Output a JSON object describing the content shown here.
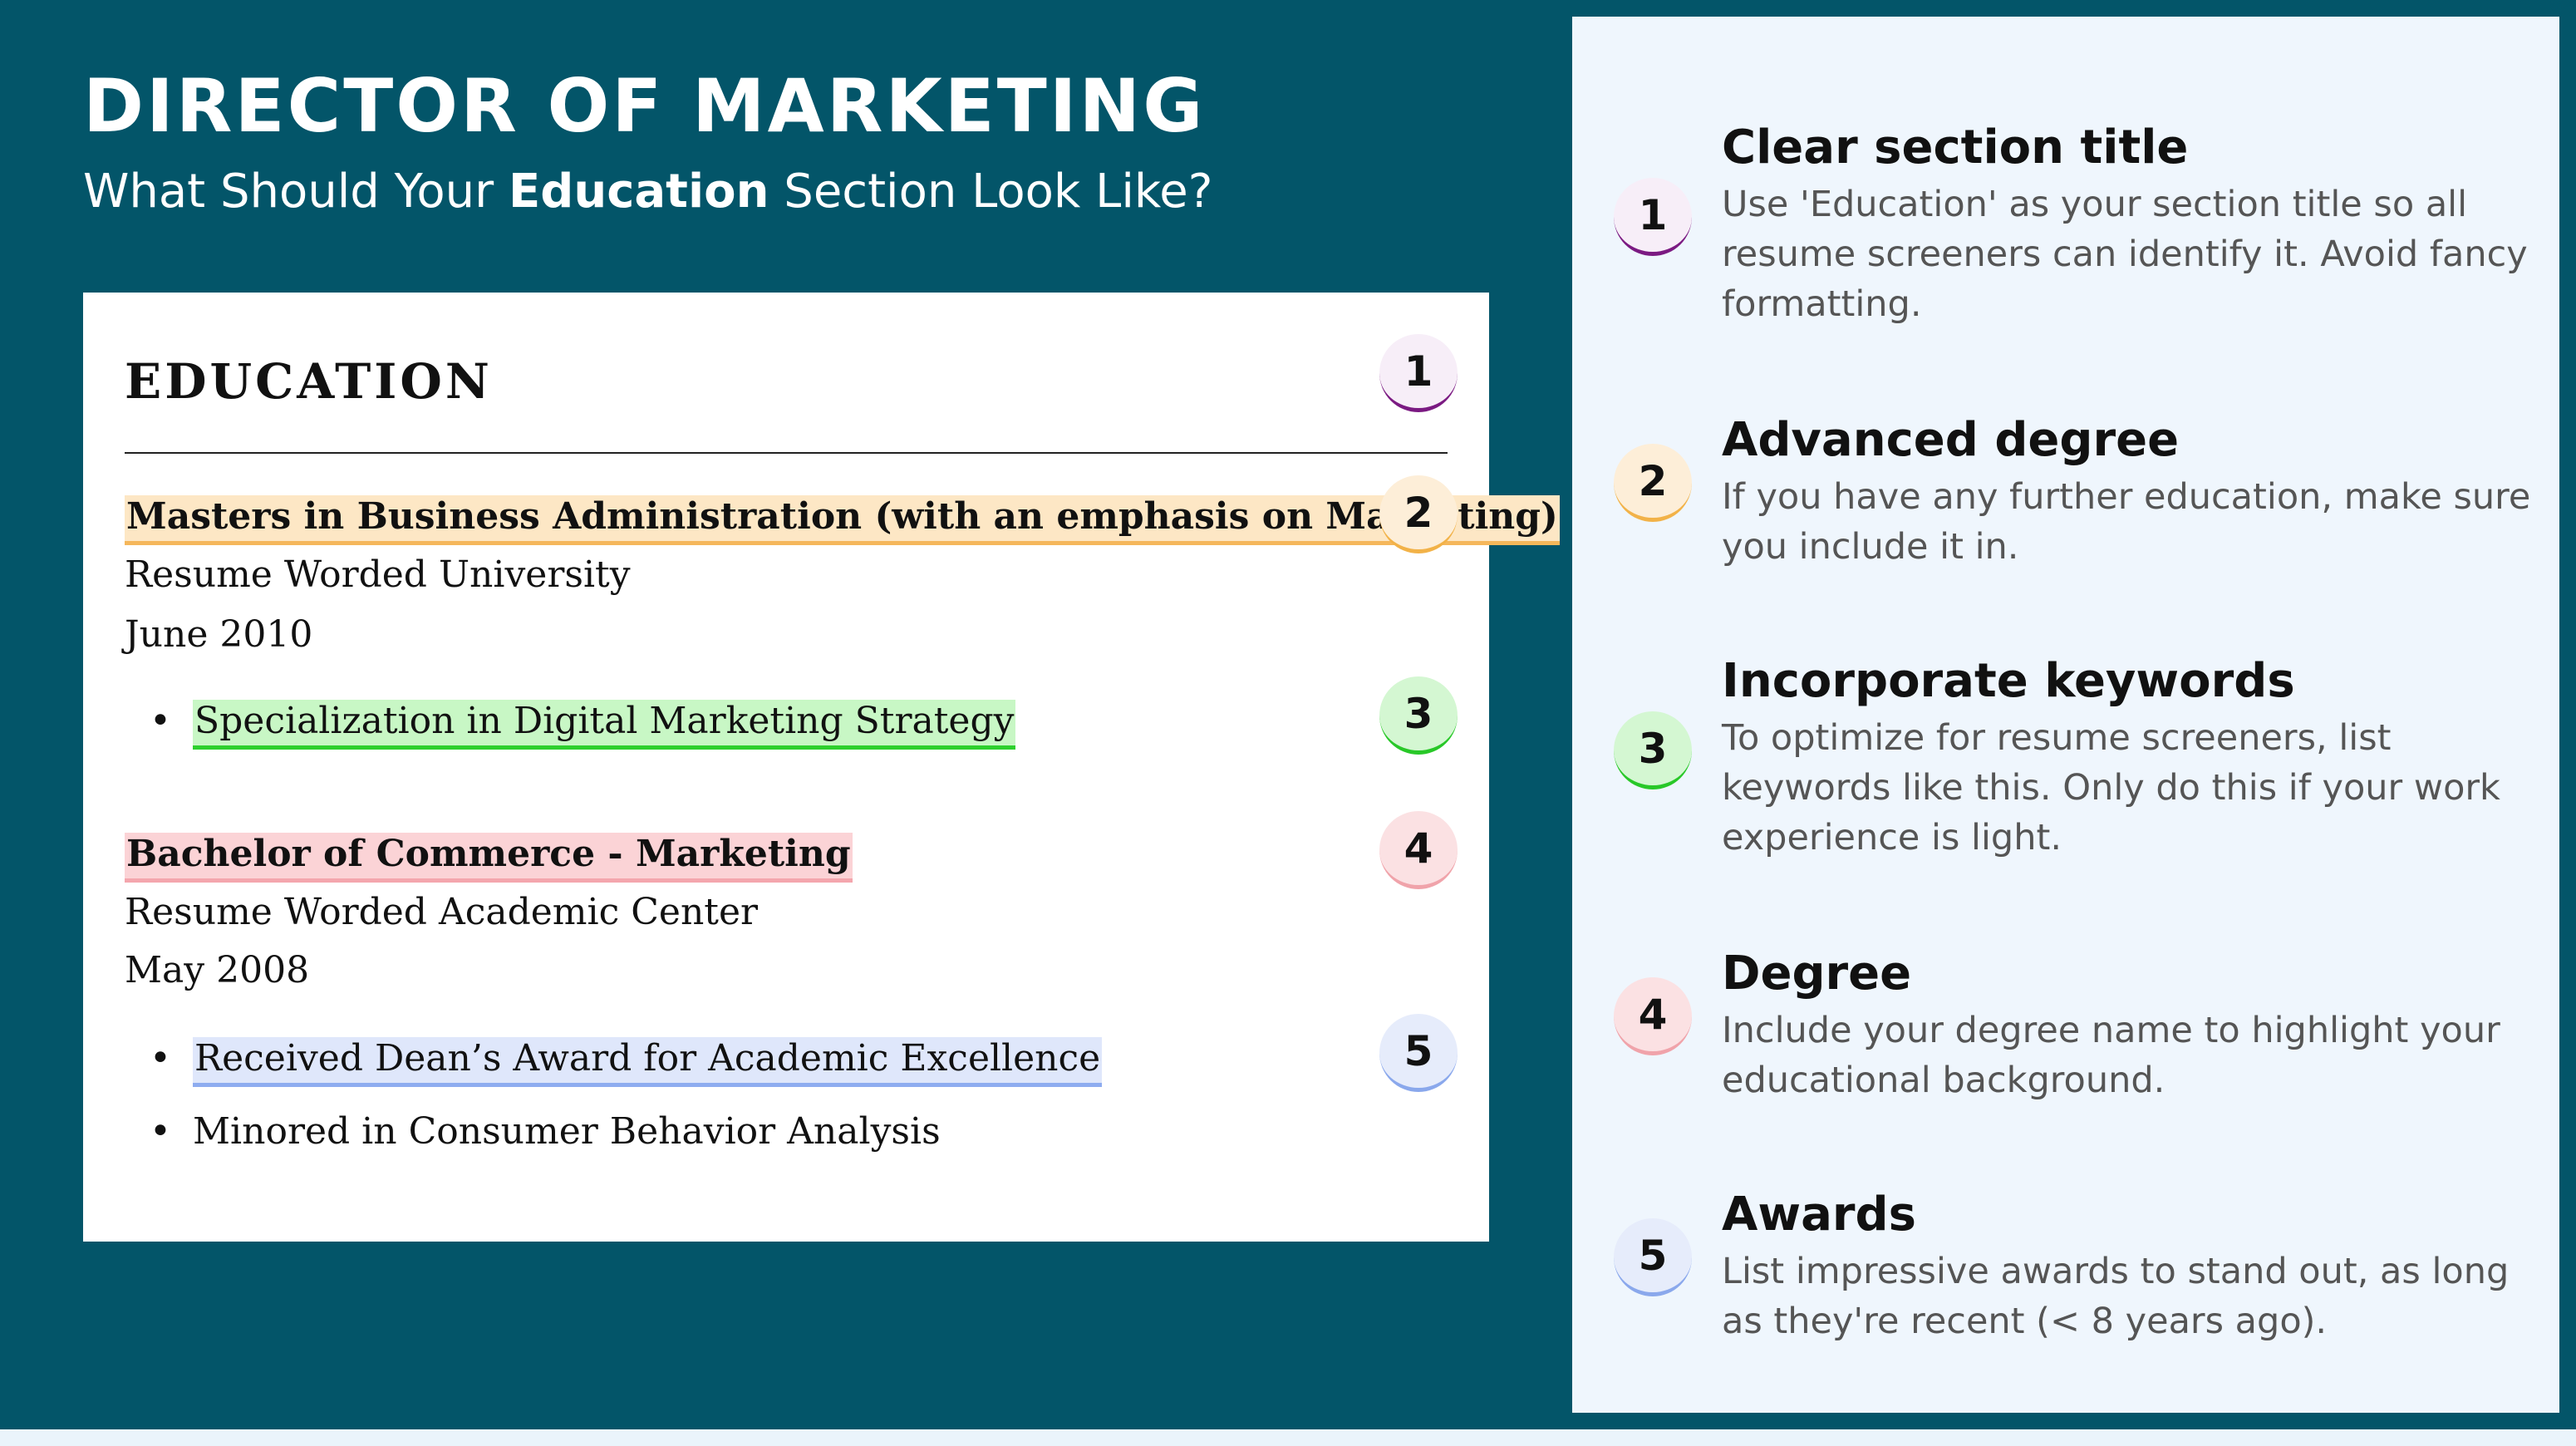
{
  "header": {
    "title": "DIRECTOR OF MARKETING",
    "subtitle_before": "What Should Your ",
    "subtitle_bold": "Education",
    "subtitle_after": " Section Look Like?"
  },
  "resume": {
    "section_title": "EDUCATION",
    "degrees": [
      {
        "name": "Masters in Business Administration (with an emphasis on Marketing)",
        "school": "Resume Worded University",
        "date": "June 2010",
        "bullets": [
          "Specialization in Digital Marketing Strategy"
        ]
      },
      {
        "name": "Bachelor of Commerce - Marketing",
        "school": "Resume Worded Academic Center",
        "date": "May 2008",
        "bullets": [
          "Received Dean’s Award for Academic Excellence",
          "Minored in Consumer Behavior Analysis"
        ]
      }
    ],
    "bullet_char": "•"
  },
  "badges": [
    "1",
    "2",
    "3",
    "4",
    "5"
  ],
  "tips": [
    {
      "number": "1",
      "title": "Clear section title",
      "description": "Use 'Education' as your section title so all resume screeners can identify it. Avoid fancy formatting."
    },
    {
      "number": "2",
      "title": "Advanced degree",
      "description": "If you have any further education, make sure you include it in."
    },
    {
      "number": "3",
      "title": "Incorporate keywords",
      "description": "To optimize for resume screeners, list keywords like this. Only do this if your work experience is light."
    },
    {
      "number": "4",
      "title": "Degree",
      "description": "Include your degree name to highlight your educational background."
    },
    {
      "number": "5",
      "title": "Awards",
      "description": "List impressive awards to stand out, as long as they're recent (< 8 years ago)."
    }
  ],
  "colors": {
    "background": "#035569",
    "panel": "#eff6fd",
    "badge1": "#7b1a82",
    "badge2": "#f2b248",
    "badge3": "#28c828",
    "badge4": "#f0a3aa",
    "badge5": "#8aa8ec"
  }
}
